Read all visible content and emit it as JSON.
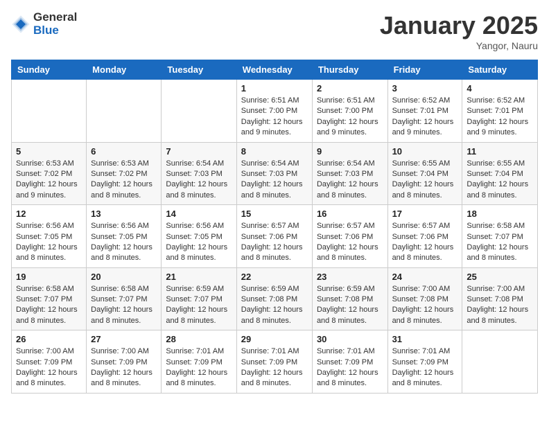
{
  "logo": {
    "general": "General",
    "blue": "Blue"
  },
  "title": "January 2025",
  "location": "Yangor, Nauru",
  "days_header": [
    "Sunday",
    "Monday",
    "Tuesday",
    "Wednesday",
    "Thursday",
    "Friday",
    "Saturday"
  ],
  "weeks": [
    [
      {
        "day": "",
        "info": ""
      },
      {
        "day": "",
        "info": ""
      },
      {
        "day": "",
        "info": ""
      },
      {
        "day": "1",
        "info": "Sunrise: 6:51 AM\nSunset: 7:00 PM\nDaylight: 12 hours and 9 minutes."
      },
      {
        "day": "2",
        "info": "Sunrise: 6:51 AM\nSunset: 7:00 PM\nDaylight: 12 hours and 9 minutes."
      },
      {
        "day": "3",
        "info": "Sunrise: 6:52 AM\nSunset: 7:01 PM\nDaylight: 12 hours and 9 minutes."
      },
      {
        "day": "4",
        "info": "Sunrise: 6:52 AM\nSunset: 7:01 PM\nDaylight: 12 hours and 9 minutes."
      }
    ],
    [
      {
        "day": "5",
        "info": "Sunrise: 6:53 AM\nSunset: 7:02 PM\nDaylight: 12 hours and 9 minutes."
      },
      {
        "day": "6",
        "info": "Sunrise: 6:53 AM\nSunset: 7:02 PM\nDaylight: 12 hours and 8 minutes."
      },
      {
        "day": "7",
        "info": "Sunrise: 6:54 AM\nSunset: 7:03 PM\nDaylight: 12 hours and 8 minutes."
      },
      {
        "day": "8",
        "info": "Sunrise: 6:54 AM\nSunset: 7:03 PM\nDaylight: 12 hours and 8 minutes."
      },
      {
        "day": "9",
        "info": "Sunrise: 6:54 AM\nSunset: 7:03 PM\nDaylight: 12 hours and 8 minutes."
      },
      {
        "day": "10",
        "info": "Sunrise: 6:55 AM\nSunset: 7:04 PM\nDaylight: 12 hours and 8 minutes."
      },
      {
        "day": "11",
        "info": "Sunrise: 6:55 AM\nSunset: 7:04 PM\nDaylight: 12 hours and 8 minutes."
      }
    ],
    [
      {
        "day": "12",
        "info": "Sunrise: 6:56 AM\nSunset: 7:05 PM\nDaylight: 12 hours and 8 minutes."
      },
      {
        "day": "13",
        "info": "Sunrise: 6:56 AM\nSunset: 7:05 PM\nDaylight: 12 hours and 8 minutes."
      },
      {
        "day": "14",
        "info": "Sunrise: 6:56 AM\nSunset: 7:05 PM\nDaylight: 12 hours and 8 minutes."
      },
      {
        "day": "15",
        "info": "Sunrise: 6:57 AM\nSunset: 7:06 PM\nDaylight: 12 hours and 8 minutes."
      },
      {
        "day": "16",
        "info": "Sunrise: 6:57 AM\nSunset: 7:06 PM\nDaylight: 12 hours and 8 minutes."
      },
      {
        "day": "17",
        "info": "Sunrise: 6:57 AM\nSunset: 7:06 PM\nDaylight: 12 hours and 8 minutes."
      },
      {
        "day": "18",
        "info": "Sunrise: 6:58 AM\nSunset: 7:07 PM\nDaylight: 12 hours and 8 minutes."
      }
    ],
    [
      {
        "day": "19",
        "info": "Sunrise: 6:58 AM\nSunset: 7:07 PM\nDaylight: 12 hours and 8 minutes."
      },
      {
        "day": "20",
        "info": "Sunrise: 6:58 AM\nSunset: 7:07 PM\nDaylight: 12 hours and 8 minutes."
      },
      {
        "day": "21",
        "info": "Sunrise: 6:59 AM\nSunset: 7:07 PM\nDaylight: 12 hours and 8 minutes."
      },
      {
        "day": "22",
        "info": "Sunrise: 6:59 AM\nSunset: 7:08 PM\nDaylight: 12 hours and 8 minutes."
      },
      {
        "day": "23",
        "info": "Sunrise: 6:59 AM\nSunset: 7:08 PM\nDaylight: 12 hours and 8 minutes."
      },
      {
        "day": "24",
        "info": "Sunrise: 7:00 AM\nSunset: 7:08 PM\nDaylight: 12 hours and 8 minutes."
      },
      {
        "day": "25",
        "info": "Sunrise: 7:00 AM\nSunset: 7:08 PM\nDaylight: 12 hours and 8 minutes."
      }
    ],
    [
      {
        "day": "26",
        "info": "Sunrise: 7:00 AM\nSunset: 7:09 PM\nDaylight: 12 hours and 8 minutes."
      },
      {
        "day": "27",
        "info": "Sunrise: 7:00 AM\nSunset: 7:09 PM\nDaylight: 12 hours and 8 minutes."
      },
      {
        "day": "28",
        "info": "Sunrise: 7:01 AM\nSunset: 7:09 PM\nDaylight: 12 hours and 8 minutes."
      },
      {
        "day": "29",
        "info": "Sunrise: 7:01 AM\nSunset: 7:09 PM\nDaylight: 12 hours and 8 minutes."
      },
      {
        "day": "30",
        "info": "Sunrise: 7:01 AM\nSunset: 7:09 PM\nDaylight: 12 hours and 8 minutes."
      },
      {
        "day": "31",
        "info": "Sunrise: 7:01 AM\nSunset: 7:09 PM\nDaylight: 12 hours and 8 minutes."
      },
      {
        "day": "",
        "info": ""
      }
    ]
  ]
}
